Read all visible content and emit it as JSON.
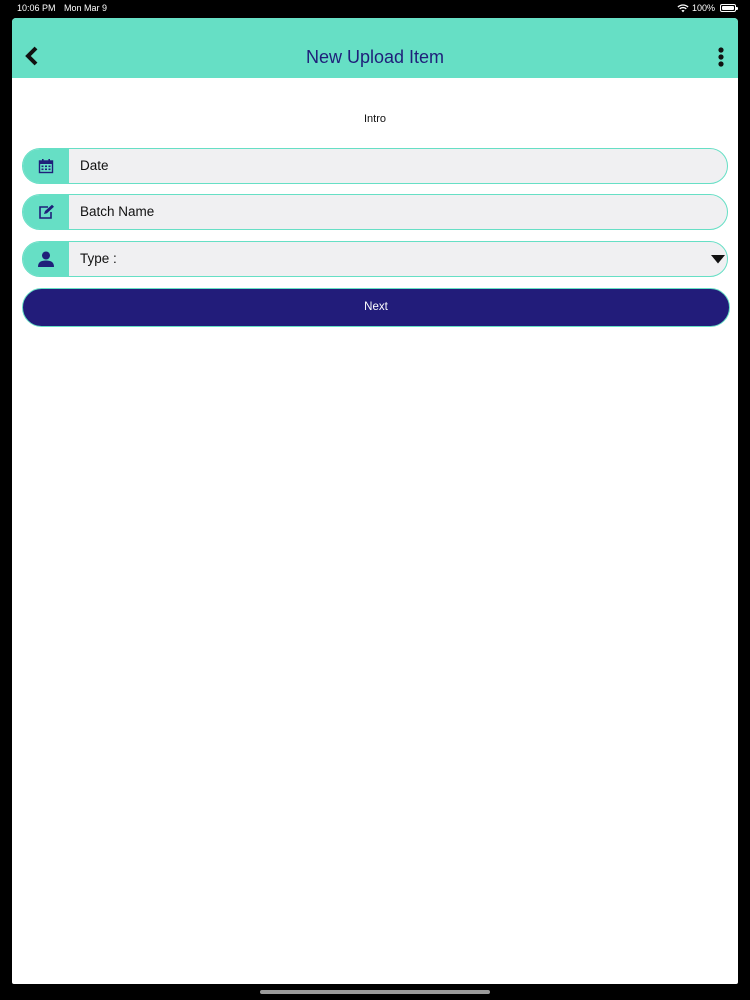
{
  "status_bar": {
    "time": "10:06 PM",
    "date": "Mon Mar 9",
    "battery": "100%",
    "icons": [
      "wifi-icon",
      "battery-icon"
    ]
  },
  "navbar": {
    "title": "New Upload Item",
    "back_icon": "chevron-left-icon",
    "menu_icon": "more-vertical-icon"
  },
  "form": {
    "intro": "Intro",
    "date_field": {
      "placeholder": "Date",
      "icon": "calendar-icon"
    },
    "batch_field": {
      "placeholder": "Batch Name",
      "icon": "edit-icon"
    },
    "type_field": {
      "label": "Type :",
      "icon": "user-icon",
      "caret_icon": "caret-down-icon"
    },
    "next_label": "Next"
  },
  "colors": {
    "accent": "#66dfc5",
    "primary": "#221c7a",
    "title_text": "#1f1f7a",
    "field_bg": "#f0f0f2"
  }
}
